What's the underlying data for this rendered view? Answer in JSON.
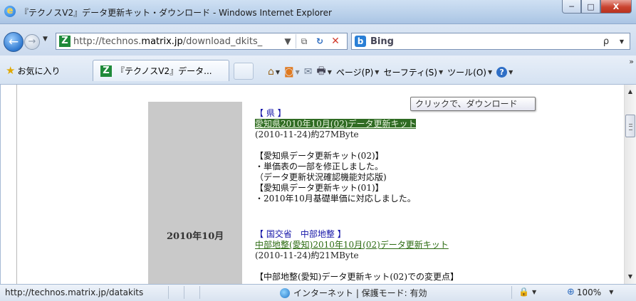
{
  "window": {
    "title": "『テクノスV2』データ更新キット・ダウンロード - Windows Internet Explorer",
    "app_icon": "ie-icon",
    "controls": {
      "minimize": "─",
      "maximize": "□",
      "close": "X"
    }
  },
  "nav": {
    "back_glyph": "←",
    "forward_glyph": "→",
    "dropdown_glyph": "▼",
    "address": {
      "prefix": "http://technos.",
      "domain": "matrix.jp",
      "path": "/download_dkits_",
      "dropdown_glyph": "▼"
    },
    "search": {
      "provider": "Bing",
      "go_glyph": "ρ",
      "dropdown_glyph": "▼"
    }
  },
  "command": {
    "favorites_label": "お気に入り",
    "tab_title": "『テクノスV2』データ...",
    "page_menu": "ページ(P)",
    "safety_menu": "セーフティ(S)",
    "tools_menu": "ツール(O)",
    "help_glyph": "?",
    "more_glyph": "»"
  },
  "content": {
    "date_label": "2010年10月",
    "entries": [
      {
        "category": "【 県 】",
        "link": "愛知県2010年10月(02)データ更新キット",
        "meta": "(2010-11-24)約27MByte",
        "notes": [
          "【愛知県データ更新キット(02)】",
          "・単価表の一部を修正しました。",
          "（データ更新状況確認機能対応版)",
          "【愛知県データ更新キット(01)】",
          "・2010年10月基礎単価に対応しました。"
        ]
      },
      {
        "category": "【 国交省　中部地整 】",
        "link": "中部地整(愛知)2010年10月(02)データ更新キット",
        "meta": "(2010-11-24)約21MByte",
        "notes": [
          "【中部地整(愛知)データ更新キット(02)での変更点】"
        ]
      }
    ],
    "tooltip": "クリックで、ダウンロード"
  },
  "scrollbar": {
    "up_glyph": "▲",
    "down_glyph": "▼"
  },
  "status": {
    "url": "http://technos.matrix.jp/datakits",
    "zone": "インターネット | 保護モード: 有効",
    "zoom": "100%",
    "dropdown_glyph": "▼"
  }
}
